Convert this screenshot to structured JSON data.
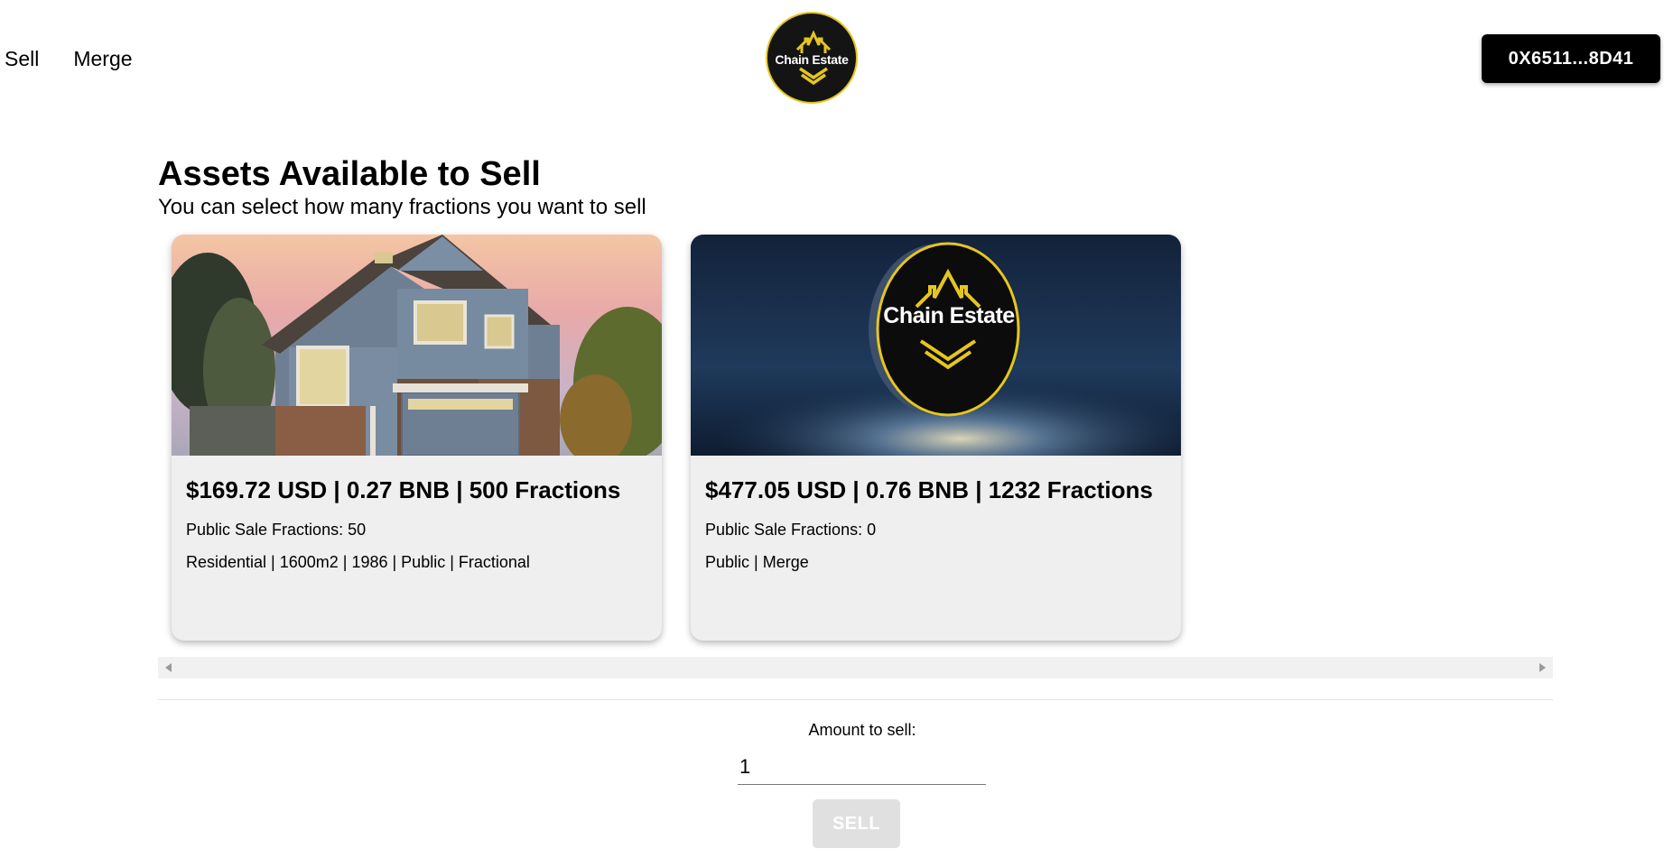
{
  "nav": {
    "items": [
      {
        "label": "Sell"
      },
      {
        "label": "Merge"
      }
    ]
  },
  "logo": {
    "text": "Chain Estate",
    "border_color": "#e6c61e",
    "bg_color": "#141414"
  },
  "wallet": {
    "address": "0X6511...8D41"
  },
  "heading": {
    "title": "Assets Available to Sell",
    "subtitle": "You can select how many fractions you want to sell"
  },
  "cards": [
    {
      "image": "house-photo",
      "title": "$169.72 USD | 0.27 BNB | 500 Fractions",
      "public_sale": "Public Sale Fractions: 50",
      "details": "Residential | 1600m2 | 1986 | Public | Fractional"
    },
    {
      "image": "chain-estate-coin-photo",
      "coin_text": "Chain Estate",
      "title": "$477.05 USD | 0.76 BNB | 1232 Fractions",
      "public_sale": "Public Sale Fractions: 0",
      "details": "Public | Merge"
    }
  ],
  "sell_form": {
    "amount_label": "Amount to sell:",
    "amount_value": "1",
    "sell_label": "SELL"
  },
  "colors": {
    "accent_yellow": "#e6c61e",
    "card_bg": "#efefef",
    "button_disabled": "#e0e0e0"
  }
}
